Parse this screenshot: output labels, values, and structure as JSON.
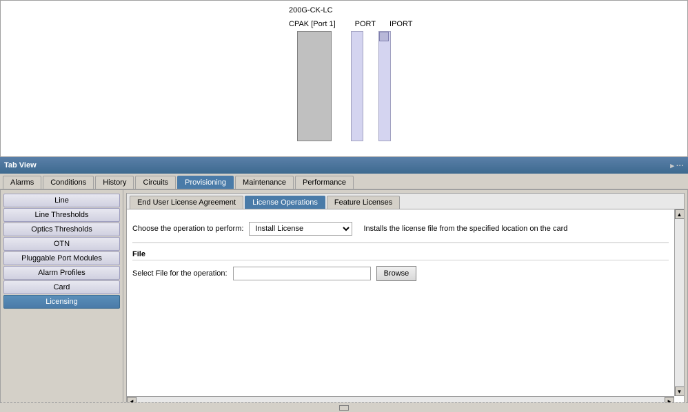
{
  "diagram": {
    "device_label": "200G-CK-LC",
    "port_labels": {
      "cpak": "CPAK [Port 1]",
      "port": "PORT",
      "iport": "IPORT"
    }
  },
  "tab_view": {
    "title": "Tab View",
    "actions": "▸ ···"
  },
  "main_tabs": [
    {
      "label": "Alarms",
      "active": false
    },
    {
      "label": "Conditions",
      "active": false
    },
    {
      "label": "History",
      "active": false
    },
    {
      "label": "Circuits",
      "active": false
    },
    {
      "label": "Provisioning",
      "active": true
    },
    {
      "label": "Maintenance",
      "active": false
    },
    {
      "label": "Performance",
      "active": false
    }
  ],
  "sidebar": {
    "items": [
      {
        "label": "Line",
        "active": false
      },
      {
        "label": "Line Thresholds",
        "active": false
      },
      {
        "label": "Optics Thresholds",
        "active": false
      },
      {
        "label": "OTN",
        "active": false
      },
      {
        "label": "Pluggable Port Modules",
        "active": false
      },
      {
        "label": "Alarm Profiles",
        "active": false
      },
      {
        "label": "Card",
        "active": false
      },
      {
        "label": "Licensing",
        "active": true
      }
    ]
  },
  "sub_tabs": [
    {
      "label": "End User License Agreement",
      "active": false
    },
    {
      "label": "License Operations",
      "active": true
    },
    {
      "label": "Feature Licenses",
      "active": false
    }
  ],
  "license_operations": {
    "operation_label": "Choose the operation to perform:",
    "operation_value": "Install License",
    "operation_description": "Installs the license file from the specified location on the card",
    "file_section_label": "File",
    "file_select_label": "Select File for the operation:",
    "file_input_placeholder": "",
    "browse_button_label": "Browse"
  }
}
